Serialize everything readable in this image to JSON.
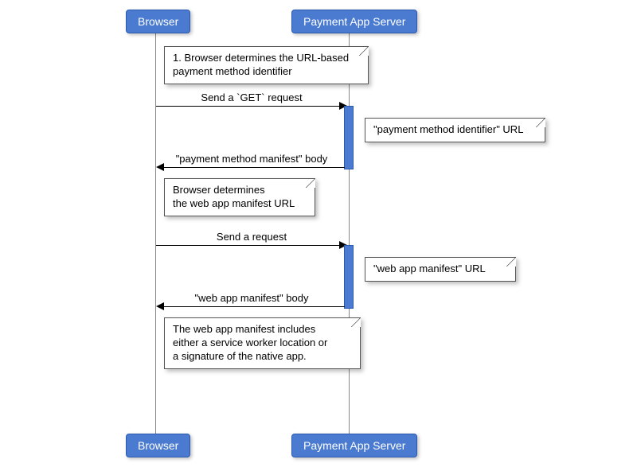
{
  "participants": {
    "browser": "Browser",
    "server": "Payment App Server"
  },
  "notes": {
    "n1": "1. Browser determines the URL-based\npayment method identifier",
    "n2": "\"payment method identifier\" URL",
    "n3": "Browser determines\nthe web app manifest URL",
    "n4": "\"web app manifest\" URL",
    "n5": "The web app manifest includes\neither a service worker location or\na signature of the native app."
  },
  "messages": {
    "m1": "Send a `GET` request",
    "m2": "\"payment method manifest\" body",
    "m3": "Send a request",
    "m4": "\"web app manifest\" body"
  }
}
